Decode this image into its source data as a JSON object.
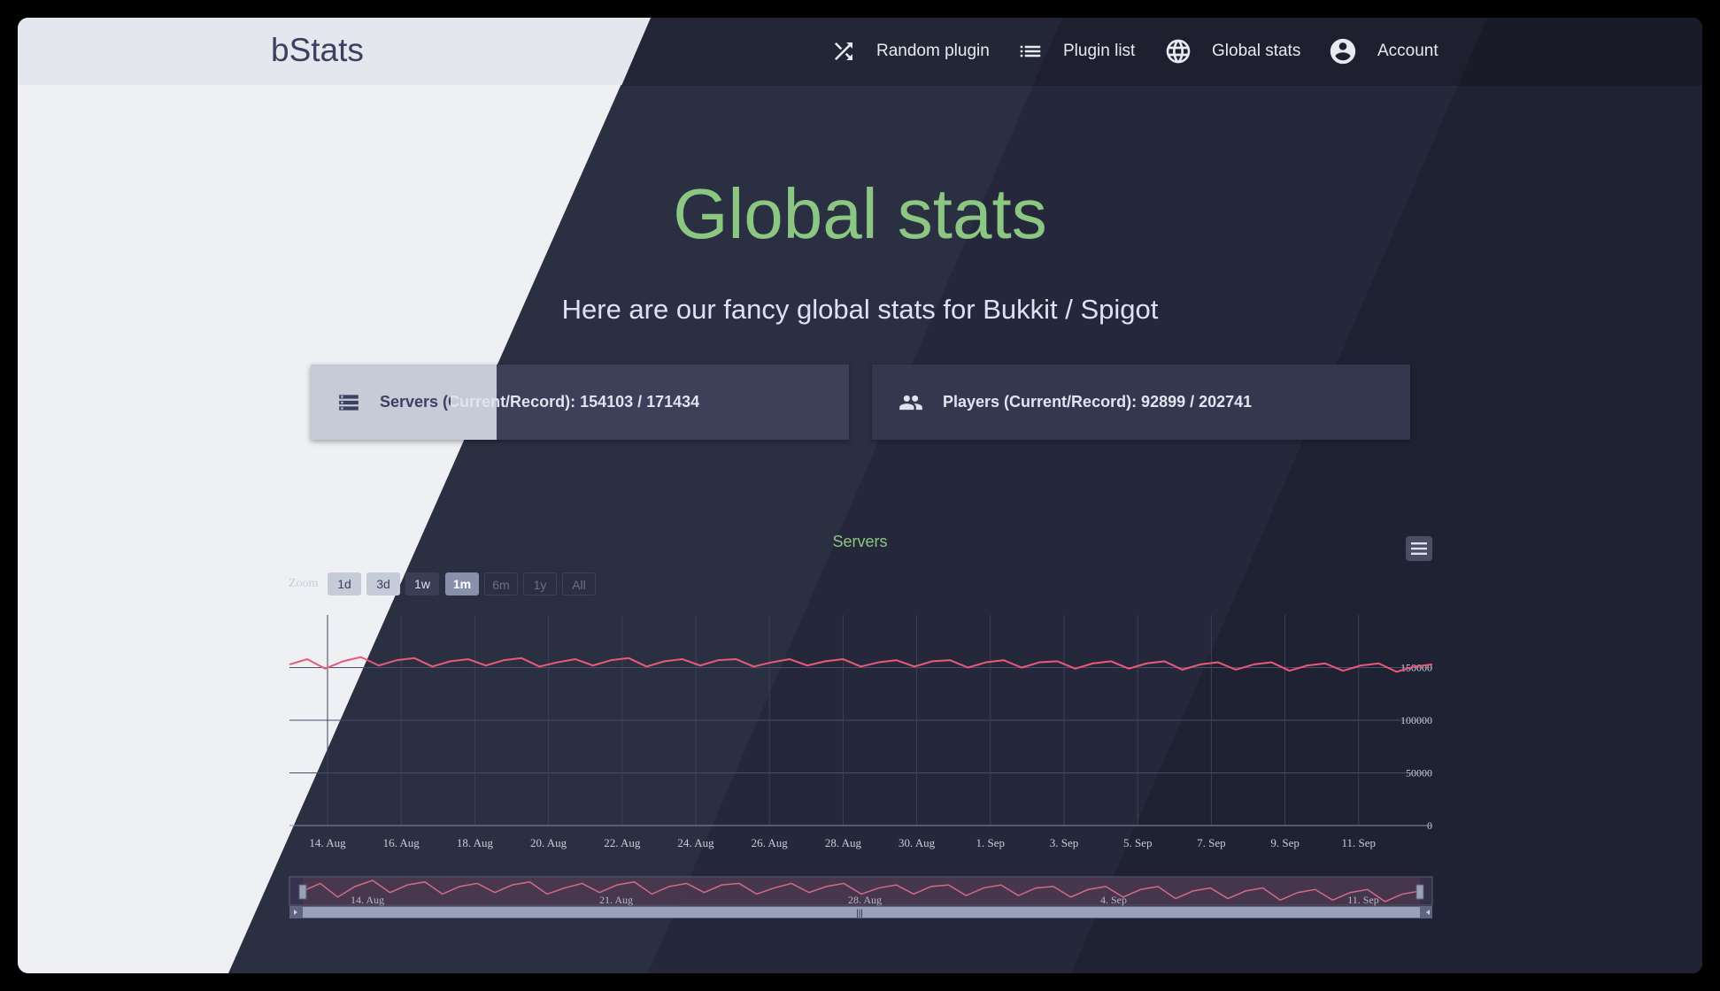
{
  "header": {
    "logo": "bStats",
    "nav": [
      {
        "icon": "shuffle-icon",
        "label": "Random plugin"
      },
      {
        "icon": "list-icon",
        "label": "Plugin list"
      },
      {
        "icon": "globe-icon",
        "label": "Global stats"
      },
      {
        "icon": "account-circle-icon",
        "label": "Account"
      }
    ]
  },
  "page": {
    "title": "Global stats",
    "subtitle": "Here are our fancy global stats for Bukkit / Spigot"
  },
  "cards": [
    {
      "icon": "server-icon",
      "label": "Servers (Current/Record): 154103 / 171434"
    },
    {
      "icon": "people-icon",
      "label": "Players (Current/Record): 92899 / 202741"
    }
  ],
  "colors": {
    "accent_green": "#8bc682",
    "line_red": "#ea5a78",
    "dark_panel": "#2b2f42",
    "light_panel": "#eff0f4"
  },
  "zoom": {
    "label": "Zoom",
    "options": [
      "1d",
      "3d",
      "1w",
      "1m",
      "6m",
      "1y",
      "All"
    ],
    "selected": "1m"
  },
  "chart_data": {
    "type": "line",
    "title": "Servers",
    "series": [
      {
        "values": [
          153000,
          158000,
          149000,
          156000,
          160000,
          152000,
          157000,
          159000,
          151000,
          156000,
          158000,
          152000,
          157000,
          159000,
          151000,
          155000,
          158000,
          152000,
          157000,
          159000,
          151000,
          156000,
          158000,
          152000,
          157000,
          158000,
          151000,
          155000,
          158000,
          152000,
          156000,
          158000,
          151000,
          155000,
          157000,
          151000,
          156000,
          157000,
          150000,
          155000,
          157000,
          150000,
          155000,
          156000,
          149000,
          154000,
          156000,
          149000,
          154000,
          156000,
          148000,
          153000,
          155000,
          148000,
          153000,
          155000,
          147000,
          152000,
          154000,
          147000,
          152000,
          154000,
          146000,
          151000,
          153000
        ]
      }
    ],
    "x_range": [
      "13. Aug",
      "12. Sep"
    ],
    "xticks": [
      "14. Aug",
      "16. Aug",
      "18. Aug",
      "20. Aug",
      "22. Aug",
      "24. Aug",
      "26. Aug",
      "28. Aug",
      "30. Aug",
      "1. Sep",
      "3. Sep",
      "5. Sep",
      "7. Sep",
      "9. Sep",
      "11. Sep"
    ],
    "yticks": [
      "0",
      "50000",
      "100000",
      "150000"
    ],
    "ylim": [
      0,
      200000
    ],
    "grid": true,
    "navigator_ticks": [
      "14. Aug",
      "21. Aug",
      "28. Aug",
      "4. Sep",
      "11. Sep"
    ]
  }
}
